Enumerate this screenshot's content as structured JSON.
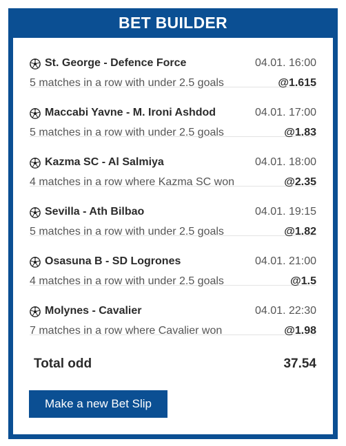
{
  "header": {
    "title": "BET BUILDER"
  },
  "bets": [
    {
      "match": "St. George - Defence Force",
      "datetime": "04.01. 16:00",
      "description": "5 matches in a row with under 2.5 goals",
      "odd": "@1.615"
    },
    {
      "match": "Maccabi Yavne - M. Ironi Ashdod",
      "datetime": "04.01. 17:00",
      "description": "5 matches in a row with under 2.5 goals",
      "odd": "@1.83"
    },
    {
      "match": "Kazma SC - Al Salmiya",
      "datetime": "04.01. 18:00",
      "description": "4 matches in a row where Kazma SC won",
      "odd": "@2.35"
    },
    {
      "match": "Sevilla - Ath Bilbao",
      "datetime": "04.01. 19:15",
      "description": "5 matches in a row with under 2.5 goals",
      "odd": "@1.82"
    },
    {
      "match": "Osasuna B - SD Logrones",
      "datetime": "04.01. 21:00",
      "description": "4 matches in a row with under 2.5 goals",
      "odd": "@1.5"
    },
    {
      "match": "Molynes - Cavalier",
      "datetime": "04.01. 22:30",
      "description": "7 matches in a row where Cavalier won",
      "odd": "@1.98"
    }
  ],
  "total": {
    "label": "Total odd",
    "value": "37.54"
  },
  "actions": {
    "new_slip_label": "Make a new Bet Slip"
  },
  "icons": {
    "bet_icon": "soccer-ball-icon"
  },
  "colors": {
    "brand": "#0b4f93"
  }
}
